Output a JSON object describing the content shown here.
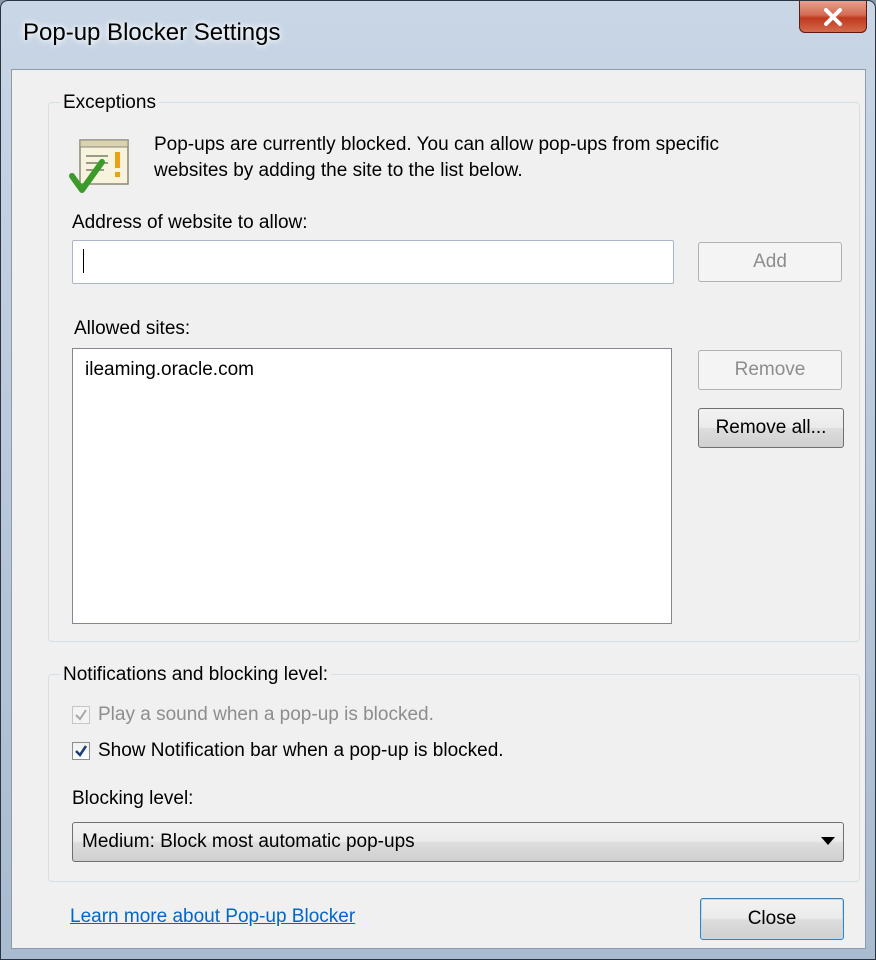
{
  "window": {
    "title": "Pop-up Blocker Settings",
    "close_icon": "close-icon"
  },
  "exceptions": {
    "legend": "Exceptions",
    "info_icon": "popup-warning-check-icon",
    "info_line1": "Pop-ups are currently blocked.  You can allow pop-ups from specific",
    "info_line2": "websites by adding the site to the list below.",
    "address_label": "Address of website to allow:",
    "address_value": "",
    "add_label": "Add",
    "allowed_label": "Allowed sites:",
    "allowed_sites": [
      "ileaming.oracle.com"
    ],
    "remove_label": "Remove",
    "remove_all_label": "Remove all..."
  },
  "notifications": {
    "legend": "Notifications and blocking level:",
    "play_sound_label": "Play a sound when a pop-up is blocked.",
    "play_sound_checked": true,
    "show_bar_label": "Show Notification bar when a pop-up is blocked.",
    "show_bar_checked": true,
    "blocking_level_label": "Blocking level:",
    "blocking_level_value": "Medium: Block most automatic pop-ups"
  },
  "footer": {
    "learn_more": "Learn more about Pop-up Blocker",
    "close_label": "Close"
  },
  "colors": {
    "link": "#0066cc",
    "close_button_red": "#c0391f",
    "checkmark_green": "#3a9a2a"
  }
}
